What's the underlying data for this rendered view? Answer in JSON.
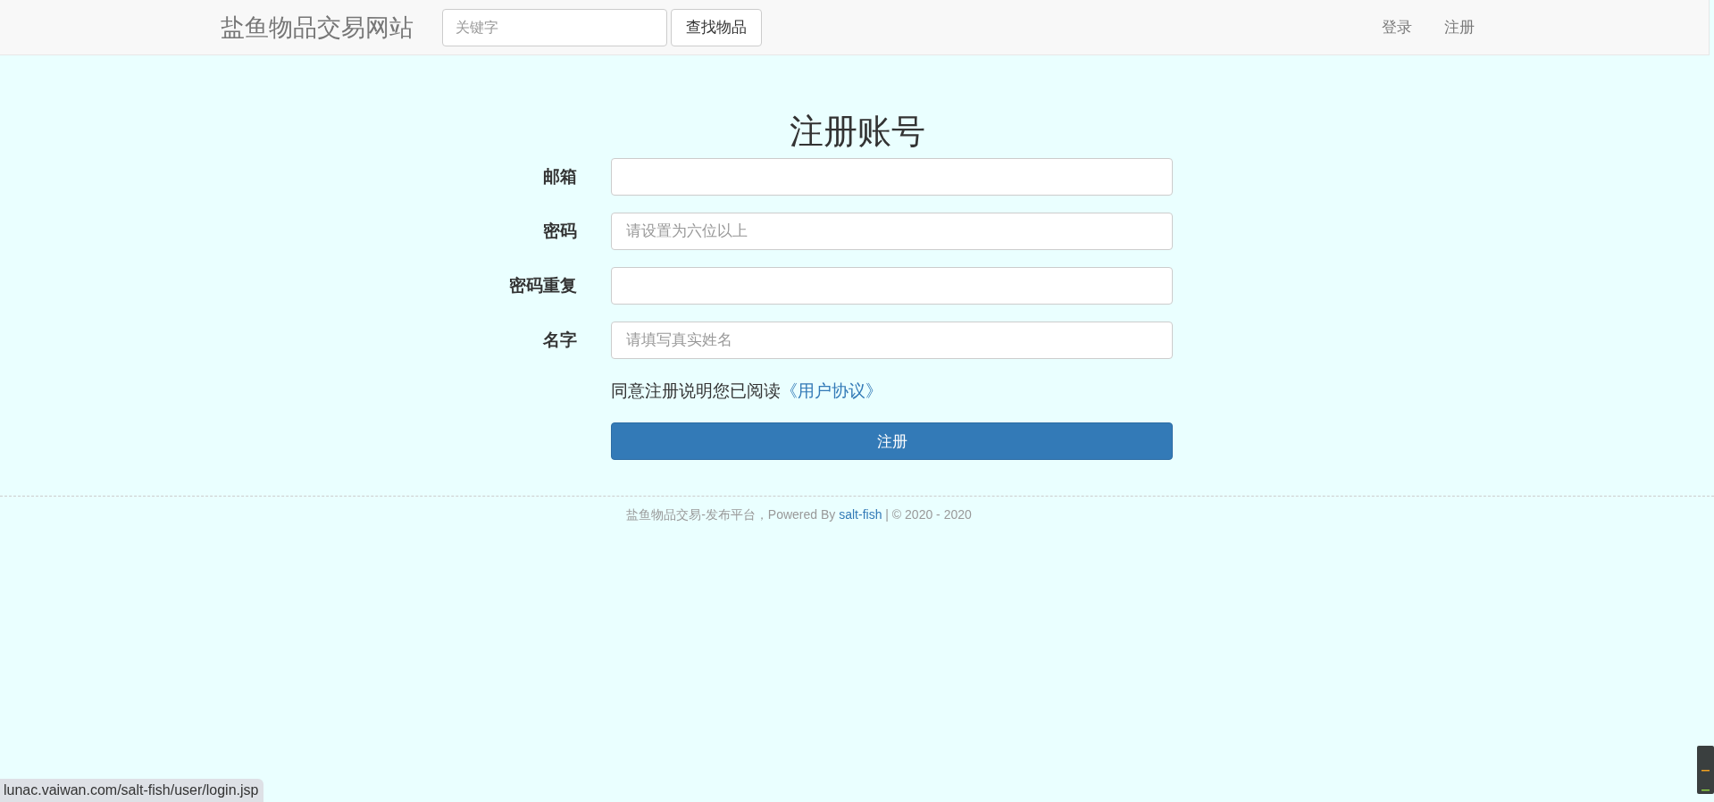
{
  "navbar": {
    "brand": "盐鱼物品交易网站",
    "search": {
      "placeholder": "关键字"
    },
    "search_button": "查找物品",
    "links": [
      "登录",
      "注册"
    ]
  },
  "form": {
    "title": "注册账号",
    "fields": [
      {
        "label": "邮箱"
      },
      {
        "label": "密码",
        "placeholder": "请设置为六位以上"
      },
      {
        "label": "密码重复"
      },
      {
        "label": "名字",
        "placeholder": "请填写真实姓名"
      }
    ],
    "agreement": {
      "text": "同意注册说明您已阅读",
      "link": "《用户协议》"
    },
    "submit": "注册"
  },
  "footer": {
    "text": "盐鱼物品交易-发布平台，Powered By ",
    "link": "salt-fish",
    "text_after": " | © 2020 - 2020"
  },
  "status_bar": {
    "url": "lunac.vaiwan.com/salt-fish/user/login.jsp"
  }
}
